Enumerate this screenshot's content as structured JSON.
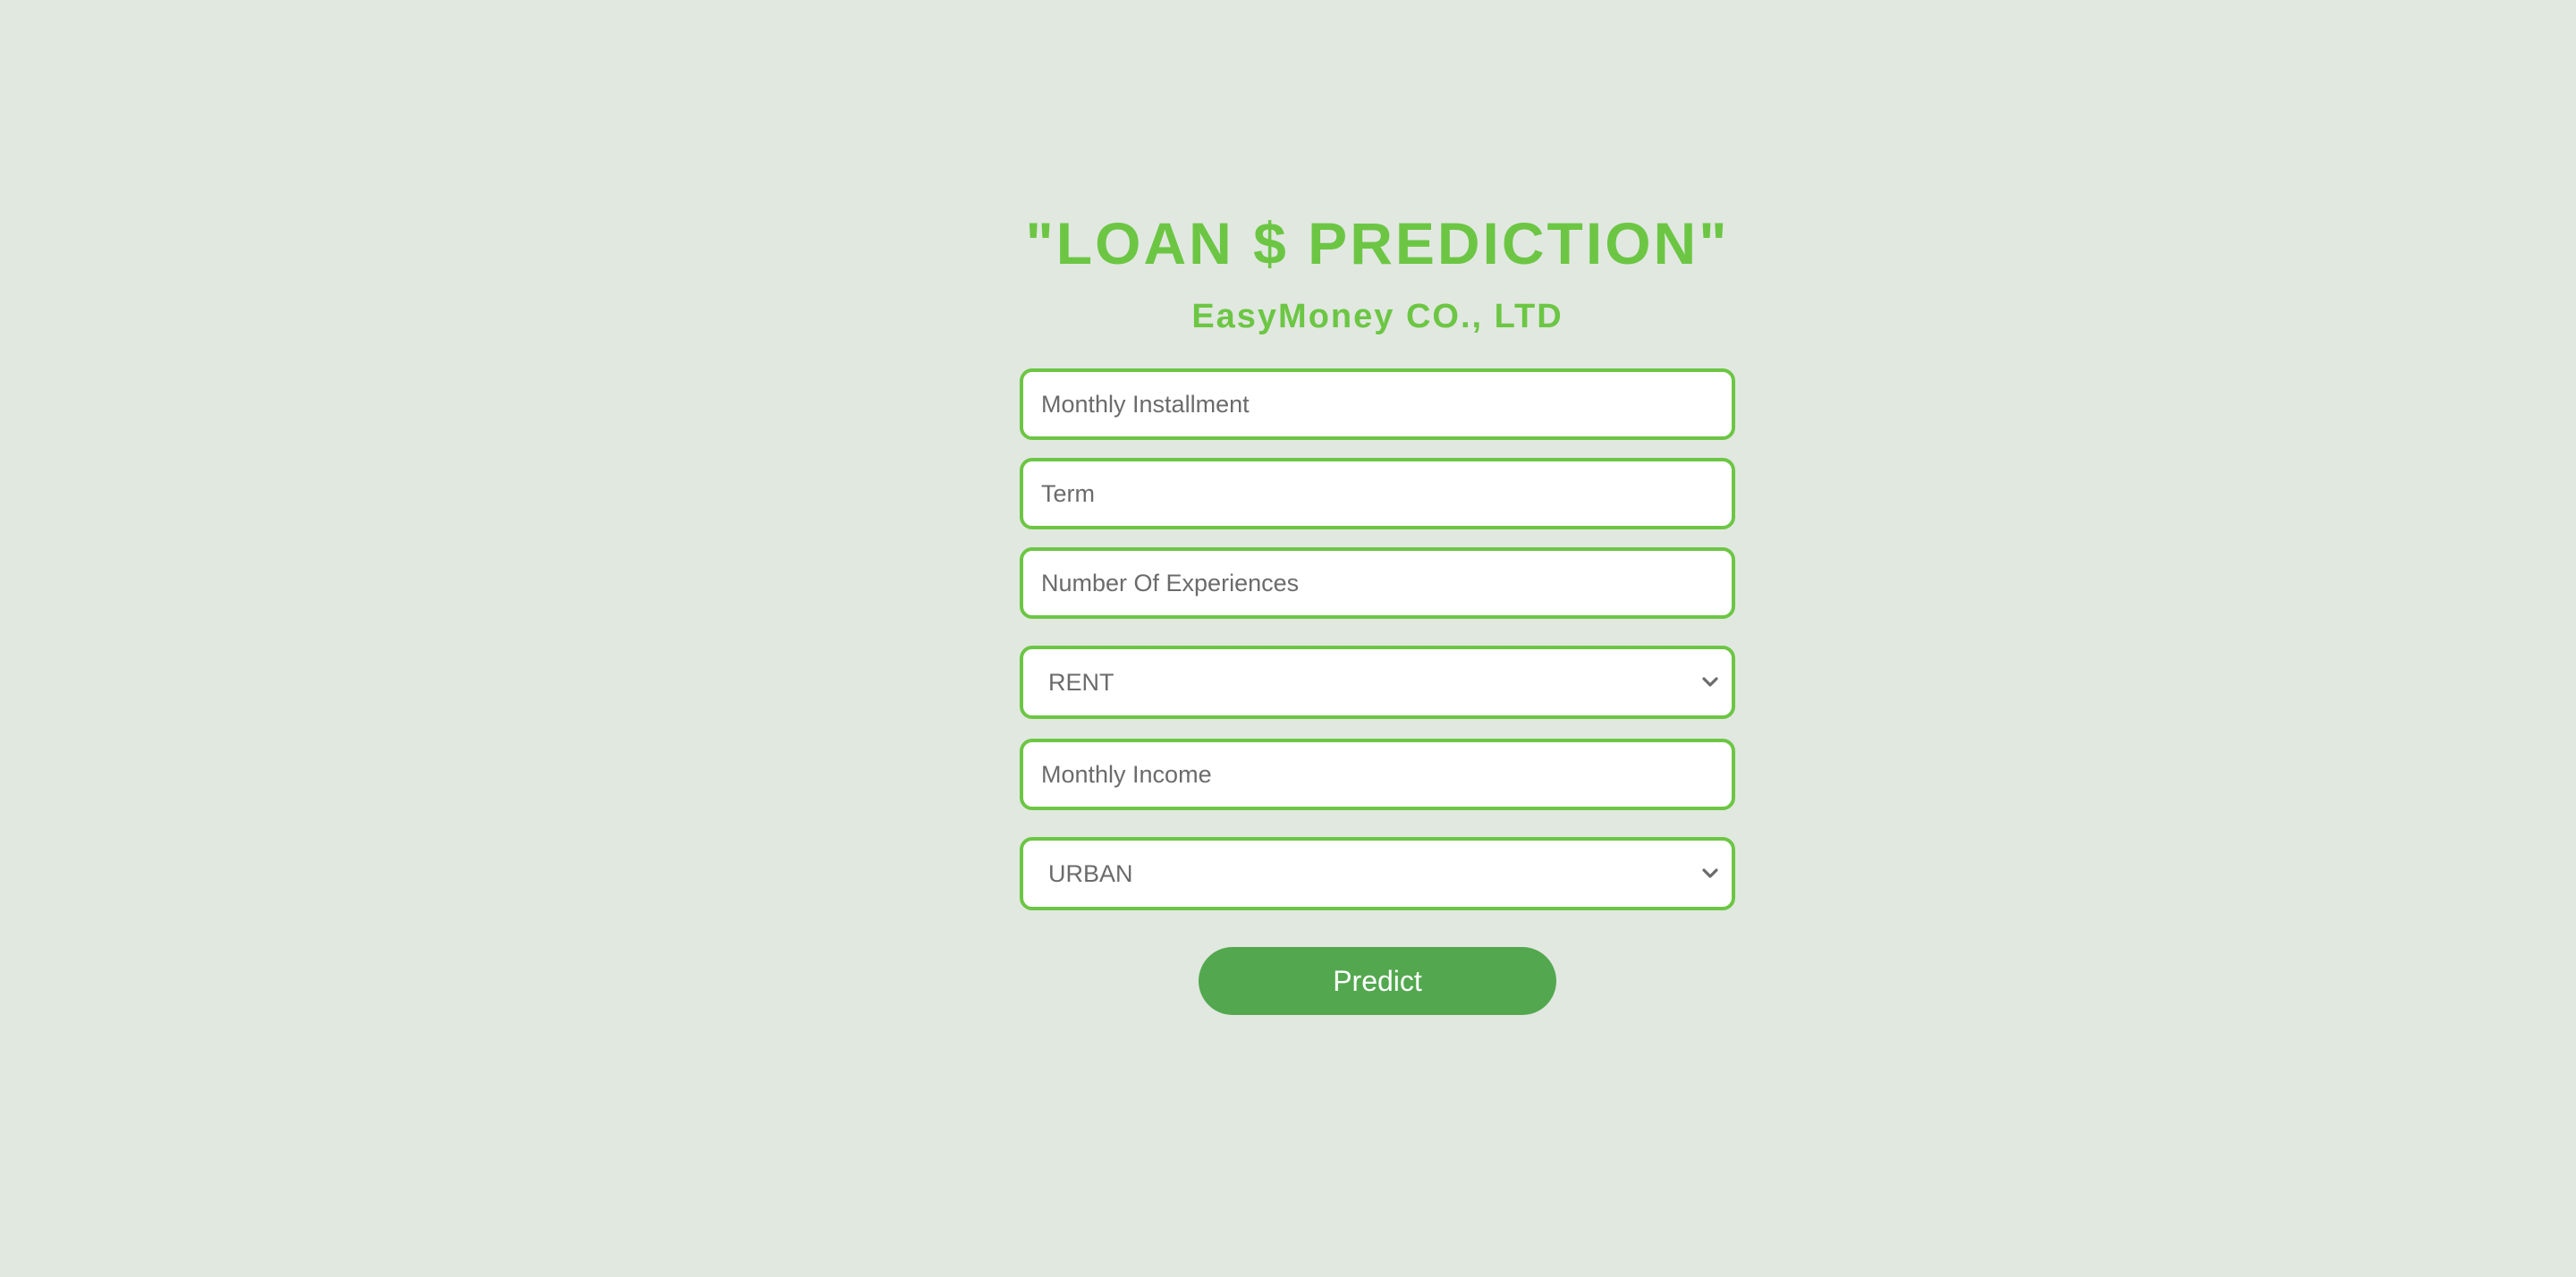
{
  "header": {
    "title": "\"LOAN $ PREDICTION\"",
    "subtitle": "EasyMoney CO., LTD"
  },
  "form": {
    "monthly_installment_placeholder": "Monthly Installment",
    "term_placeholder": "Term",
    "experiences_placeholder": "Number Of Experiences",
    "home_ownership_selected": "RENT",
    "monthly_income_placeholder": "Monthly Income",
    "area_selected": "URBAN",
    "predict_label": "Predict"
  },
  "icons": {
    "select_arrow": "chevron-down-icon"
  },
  "colors": {
    "background": "#e1e8e0",
    "accent": "#6cc644",
    "button": "#53a84f",
    "button_text": "#ffffff",
    "placeholder_text": "#6b6b6b"
  }
}
